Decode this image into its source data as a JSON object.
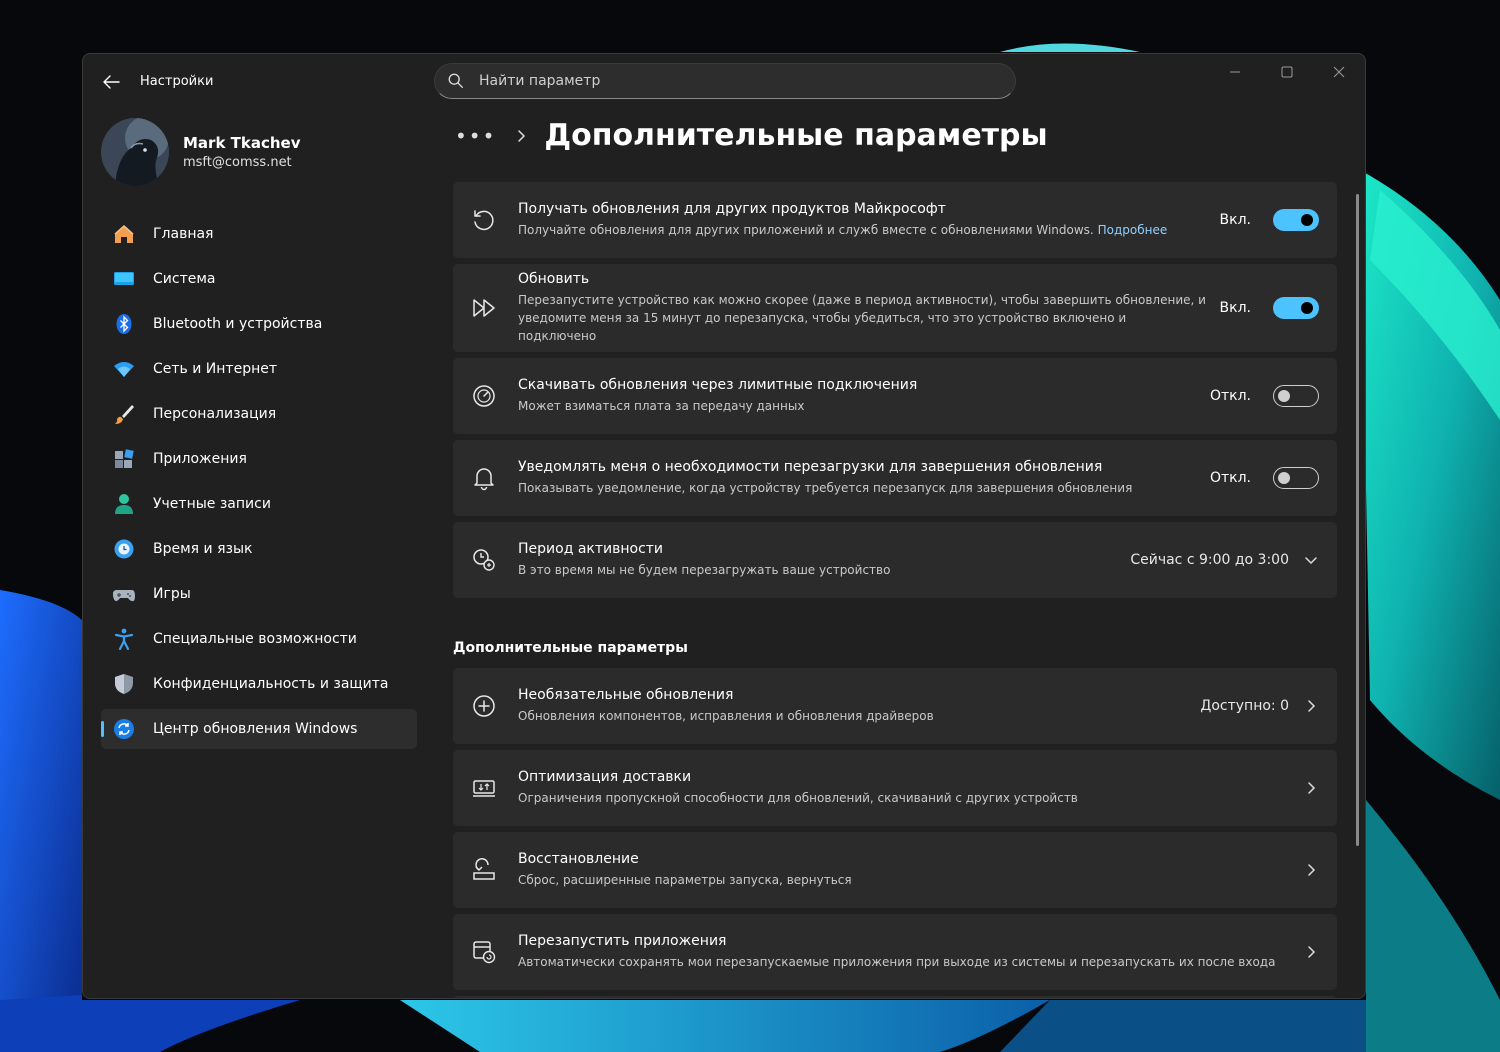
{
  "window": {
    "app_title": "Настройки",
    "search_placeholder": "Найти параметр"
  },
  "profile": {
    "name": "Mark Tkachev",
    "email": "msft@comss.net"
  },
  "sidebar": {
    "items": [
      {
        "label": "Главная",
        "icon": "home-icon"
      },
      {
        "label": "Система",
        "icon": "system-icon"
      },
      {
        "label": "Bluetooth и устройства",
        "icon": "bluetooth-icon"
      },
      {
        "label": "Сеть и Интернет",
        "icon": "wifi-icon"
      },
      {
        "label": "Персонализация",
        "icon": "brush-icon"
      },
      {
        "label": "Приложения",
        "icon": "apps-icon"
      },
      {
        "label": "Учетные записи",
        "icon": "user-icon"
      },
      {
        "label": "Время и язык",
        "icon": "clock-globe-icon"
      },
      {
        "label": "Игры",
        "icon": "gamepad-icon"
      },
      {
        "label": "Специальные возможности",
        "icon": "accessibility-icon"
      },
      {
        "label": "Конфиденциальность и защита",
        "icon": "shield-icon"
      },
      {
        "label": "Центр обновления Windows",
        "icon": "update-icon",
        "active": true
      }
    ]
  },
  "header": {
    "more": "•••",
    "title": "Дополнительные параметры"
  },
  "settings": {
    "other_products": {
      "title": "Получать обновления для других продуктов Майкрософт",
      "desc": "Получайте обновления для других приложений и служб вместе с обновлениями Windows.",
      "link": "Подробнее",
      "state_label": "Вкл.",
      "on": true
    },
    "update_asap": {
      "title": "Обновить",
      "desc": "Перезапустите устройство как можно скорее (даже в период активности), чтобы завершить обновление, и уведомите меня за 15 минут до перезапуска, чтобы убедиться, что это устройство включено и подключено",
      "state_label": "Вкл.",
      "on": true
    },
    "metered": {
      "title": "Скачивать обновления через лимитные подключения",
      "desc": "Может взиматься плата за передачу данных",
      "state_label": "Откл.",
      "on": false
    },
    "notify_restart": {
      "title": "Уведомлять меня о необходимости перезагрузки для завершения обновления",
      "desc": "Показывать уведомление, когда устройству требуется перезапуск для завершения обновления",
      "state_label": "Откл.",
      "on": false
    },
    "active_hours": {
      "title": "Период активности",
      "desc": "В это время мы не будем перезагружать ваше устройство",
      "value": "Сейчас с 9:00 до 3:00"
    }
  },
  "additional": {
    "section_title": "Дополнительные параметры",
    "optional_updates": {
      "title": "Необязательные обновления",
      "desc": "Обновления компонентов, исправления и обновления драйверов",
      "value": "Доступно: 0"
    },
    "delivery_opt": {
      "title": "Оптимизация доставки",
      "desc": "Ограничения пропускной способности для обновлений, скачиваний с других устройств"
    },
    "recovery": {
      "title": "Восстановление",
      "desc": "Сброс, расширенные параметры запуска, вернуться"
    },
    "restart_apps": {
      "title": "Перезапустить приложения",
      "desc": "Автоматически сохранять мои перезапускаемые приложения при выходе из системы и перезапускать их после входа"
    }
  },
  "colors": {
    "accent": "#4cc2ff",
    "window_bg": "#202020",
    "card_bg": "#2b2b2b"
  }
}
